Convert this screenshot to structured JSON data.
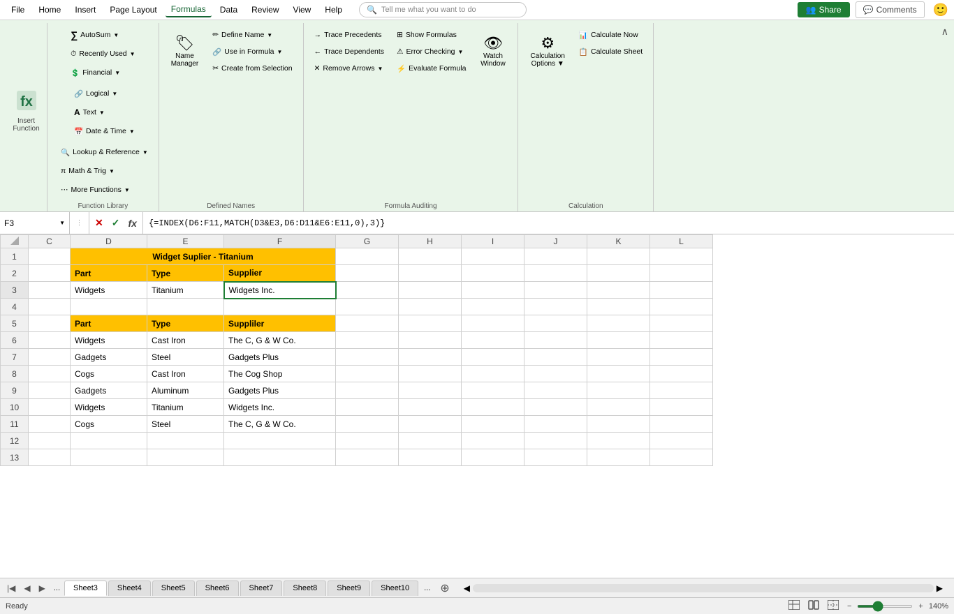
{
  "menu": {
    "items": [
      "File",
      "Home",
      "Insert",
      "Page Layout",
      "Formulas",
      "Data",
      "Review",
      "View",
      "Help"
    ],
    "active": "Formulas",
    "search_placeholder": "Tell me what you want to do",
    "share_label": "Share",
    "comments_label": "Comments"
  },
  "ribbon": {
    "groups": [
      {
        "id": "insert-function",
        "label": "",
        "large_button": {
          "icon": "fx",
          "label": "Insert\nFunction"
        }
      },
      {
        "id": "function-library",
        "label": "Function Library",
        "rows": [
          [
            {
              "icon": "∑",
              "label": "AutoSum",
              "dropdown": true
            },
            {
              "icon": "⏱",
              "label": "Recently Used",
              "dropdown": true
            },
            {
              "icon": "💰",
              "label": "Financial",
              "dropdown": true
            }
          ],
          [
            {
              "icon": "🔗",
              "label": "Logical",
              "dropdown": true
            },
            {
              "icon": "A",
              "label": "Text",
              "dropdown": true
            },
            {
              "icon": "📅",
              "label": "Date & Time",
              "dropdown": true
            }
          ],
          [
            {
              "icon": "🔍",
              "label": "Lookup & Reference",
              "dropdown": true
            },
            {
              "icon": "π",
              "label": "Math & Trig",
              "dropdown": true
            },
            {
              "icon": "⋯",
              "label": "More Functions",
              "dropdown": true
            }
          ]
        ]
      },
      {
        "id": "defined-names",
        "label": "Defined Names",
        "rows": [
          [
            {
              "icon": "🏷",
              "label": "Name Manager",
              "large": true
            }
          ],
          [
            {
              "icon": "✏",
              "label": "Define Name",
              "dropdown": true
            },
            {
              "icon": "🔗",
              "label": "Use in Formula",
              "dropdown": true
            },
            {
              "icon": "✂",
              "label": "Create from Selection"
            }
          ]
        ]
      },
      {
        "id": "formula-auditing",
        "label": "Formula Auditing",
        "rows": [
          [
            {
              "icon": "→",
              "label": "Trace Precedents"
            },
            {
              "icon": "⊞",
              "label": "Show Formulas"
            },
            {
              "icon": "👁",
              "label": "Watch Window",
              "large": true
            }
          ],
          [
            {
              "icon": "←",
              "label": "Trace Dependents"
            },
            {
              "icon": "⚠",
              "label": "Error Checking",
              "dropdown": true
            }
          ],
          [
            {
              "icon": "✕",
              "label": "Remove Arrows",
              "dropdown": true
            },
            {
              "icon": "⚡",
              "label": "Evaluate Formula"
            }
          ]
        ]
      },
      {
        "id": "calculation",
        "label": "Calculation",
        "rows": [
          [
            {
              "icon": "⚙",
              "label": "Calculation Options",
              "large": true,
              "dropdown": true
            }
          ]
        ]
      }
    ]
  },
  "formula_bar": {
    "name_box": "F3",
    "formula": "{=INDEX(D6:F11,MATCH(D3&E3,D6:D11&E6:E11,0),3)}"
  },
  "columns": [
    "C",
    "D",
    "E",
    "F",
    "G",
    "H",
    "I",
    "J",
    "K",
    "L"
  ],
  "rows": [
    {
      "row_num": 1,
      "cells": {
        "C": "",
        "D": "Widget Suplier - Titanium",
        "E": "",
        "F": "",
        "G": "",
        "H": "",
        "I": "",
        "J": "",
        "K": "",
        "L": ""
      },
      "styles": {
        "D": "title-yellow",
        "E": "title-yellow",
        "F": "title-yellow"
      }
    },
    {
      "row_num": 2,
      "cells": {
        "C": "",
        "D": "Part",
        "E": "Type",
        "F": "Supplier",
        "G": "",
        "H": "",
        "I": "",
        "J": "",
        "K": "",
        "L": ""
      },
      "styles": {
        "D": "header-yellow",
        "E": "header-yellow",
        "F": "header-yellow"
      }
    },
    {
      "row_num": 3,
      "cells": {
        "C": "",
        "D": "Widgets",
        "E": "Titanium",
        "F": "Widgets Inc.",
        "G": "",
        "H": "",
        "I": "",
        "J": "",
        "K": "",
        "L": ""
      },
      "styles": {
        "F": "active-cell"
      }
    },
    {
      "row_num": 4,
      "cells": {
        "C": "",
        "D": "",
        "E": "",
        "F": "",
        "G": "",
        "H": "",
        "I": "",
        "J": "",
        "K": "",
        "L": ""
      },
      "styles": {}
    },
    {
      "row_num": 5,
      "cells": {
        "C": "",
        "D": "Part",
        "E": "Type",
        "F": "Suppliler",
        "G": "",
        "H": "",
        "I": "",
        "J": "",
        "K": "",
        "L": ""
      },
      "styles": {
        "D": "header-yellow",
        "E": "header-yellow",
        "F": "header-yellow"
      }
    },
    {
      "row_num": 6,
      "cells": {
        "C": "",
        "D": "Widgets",
        "E": "Cast Iron",
        "F": "The C, G & W Co.",
        "G": "",
        "H": "",
        "I": "",
        "J": "",
        "K": "",
        "L": ""
      },
      "styles": {}
    },
    {
      "row_num": 7,
      "cells": {
        "C": "",
        "D": "Gadgets",
        "E": "Steel",
        "F": "Gadgets Plus",
        "G": "",
        "H": "",
        "I": "",
        "J": "",
        "K": "",
        "L": ""
      },
      "styles": {}
    },
    {
      "row_num": 8,
      "cells": {
        "C": "",
        "D": "Cogs",
        "E": "Cast Iron",
        "F": "The Cog Shop",
        "G": "",
        "H": "",
        "I": "",
        "J": "",
        "K": "",
        "L": ""
      },
      "styles": {}
    },
    {
      "row_num": 9,
      "cells": {
        "C": "",
        "D": "Gadgets",
        "E": "Aluminum",
        "F": "Gadgets Plus",
        "G": "",
        "H": "",
        "I": "",
        "J": "",
        "K": "",
        "L": ""
      },
      "styles": {}
    },
    {
      "row_num": 10,
      "cells": {
        "C": "",
        "D": "Widgets",
        "E": "Titanium",
        "F": "Widgets Inc.",
        "G": "",
        "H": "",
        "I": "",
        "J": "",
        "K": "",
        "L": ""
      },
      "styles": {}
    },
    {
      "row_num": 11,
      "cells": {
        "C": "",
        "D": "Cogs",
        "E": "Steel",
        "F": "The C, G & W Co.",
        "G": "",
        "H": "",
        "I": "",
        "J": "",
        "K": "",
        "L": ""
      },
      "styles": {}
    },
    {
      "row_num": 12,
      "cells": {
        "C": "",
        "D": "",
        "E": "",
        "F": "",
        "G": "",
        "H": "",
        "I": "",
        "J": "",
        "K": "",
        "L": ""
      },
      "styles": {}
    },
    {
      "row_num": 13,
      "cells": {
        "C": "",
        "D": "",
        "E": "",
        "F": "",
        "G": "",
        "H": "",
        "I": "",
        "J": "",
        "K": "",
        "L": ""
      },
      "styles": {}
    }
  ],
  "sheet_tabs": {
    "sheets": [
      "Sheet3",
      "Sheet4",
      "Sheet5",
      "Sheet6",
      "Sheet7",
      "Sheet8",
      "Sheet9",
      "Sheet10"
    ],
    "active": "Sheet3"
  },
  "status_bar": {
    "status": "Ready",
    "zoom": "140%"
  }
}
